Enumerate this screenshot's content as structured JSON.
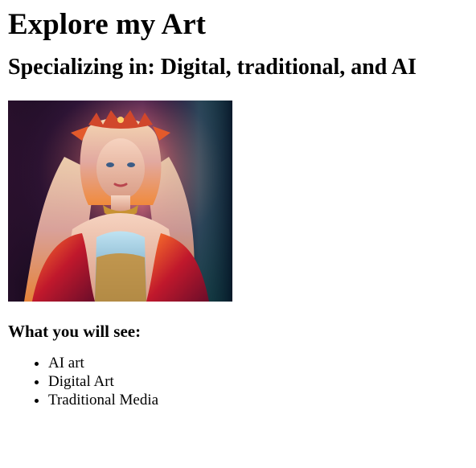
{
  "page": {
    "title": "Explore my Art",
    "subtitle": "Specializing in: Digital, traditional, and AI",
    "image": {
      "alt": "Fantasy portrait of a woman with long flowing hair and a jeweled crown"
    },
    "section_heading": "What you will see:",
    "list_items": [
      {
        "label": "AI art"
      },
      {
        "label": "Digital Art"
      },
      {
        "label": "Traditional Media"
      }
    ]
  }
}
